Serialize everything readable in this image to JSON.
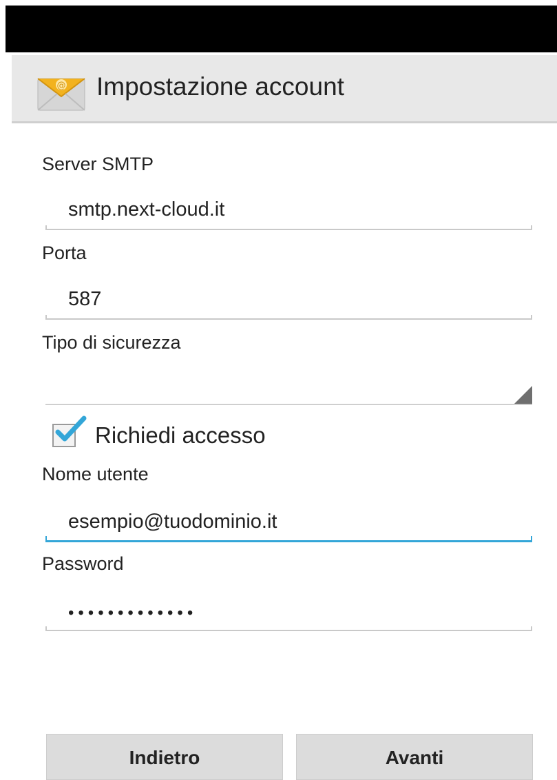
{
  "status_bar": {
    "color": "#000000"
  },
  "action_bar": {
    "icon": "email-app-icon",
    "title": "Impostazione account"
  },
  "form": {
    "smtp_server": {
      "label": "Server SMTP",
      "value": "smtp.next-cloud.it"
    },
    "port": {
      "label": "Porta",
      "value": "587"
    },
    "security_type": {
      "label": "Tipo di sicurezza",
      "value": ""
    },
    "require_login": {
      "label": "Richiedi accesso",
      "checked": true
    },
    "username": {
      "label": "Nome utente",
      "value": "esempio@tuodominio.it",
      "focused": true
    },
    "password": {
      "label": "Password",
      "value": "•••••••••••••"
    }
  },
  "buttons": {
    "back_label": "Indietro",
    "next_label": "Avanti"
  },
  "colors": {
    "accent_focus": "#33a6d8",
    "checkbox_check": "#33a6d8",
    "action_bar_bg": "#e8e8e8",
    "button_bg": "#dcdcdc"
  }
}
